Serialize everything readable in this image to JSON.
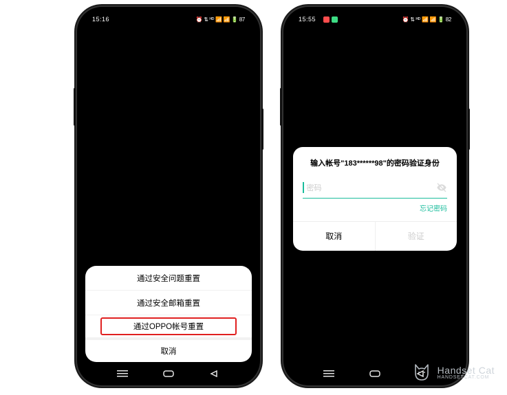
{
  "phone1": {
    "status": {
      "time": "15:16",
      "right": "⏰ ⇅ ᴴᴰ 📶 📶 🔋 87"
    },
    "sheet": {
      "items": [
        "通过安全问题重置",
        "通过安全邮箱重置",
        "通过OPPO帐号重置"
      ],
      "cancel": "取消"
    }
  },
  "phone2": {
    "status": {
      "time": "15:55",
      "right": "⏰ ⇅ ᴴᴰ 📶 📶 🔋 82"
    },
    "dialog": {
      "title": "输入帐号\"183******98\"的密码验证身份",
      "placeholder": "密码",
      "forgot": "忘记密码",
      "cancel": "取消",
      "confirm": "验证"
    }
  },
  "watermark": {
    "title": "Handset Cat",
    "sub": "HANDSETCAT.COM"
  }
}
